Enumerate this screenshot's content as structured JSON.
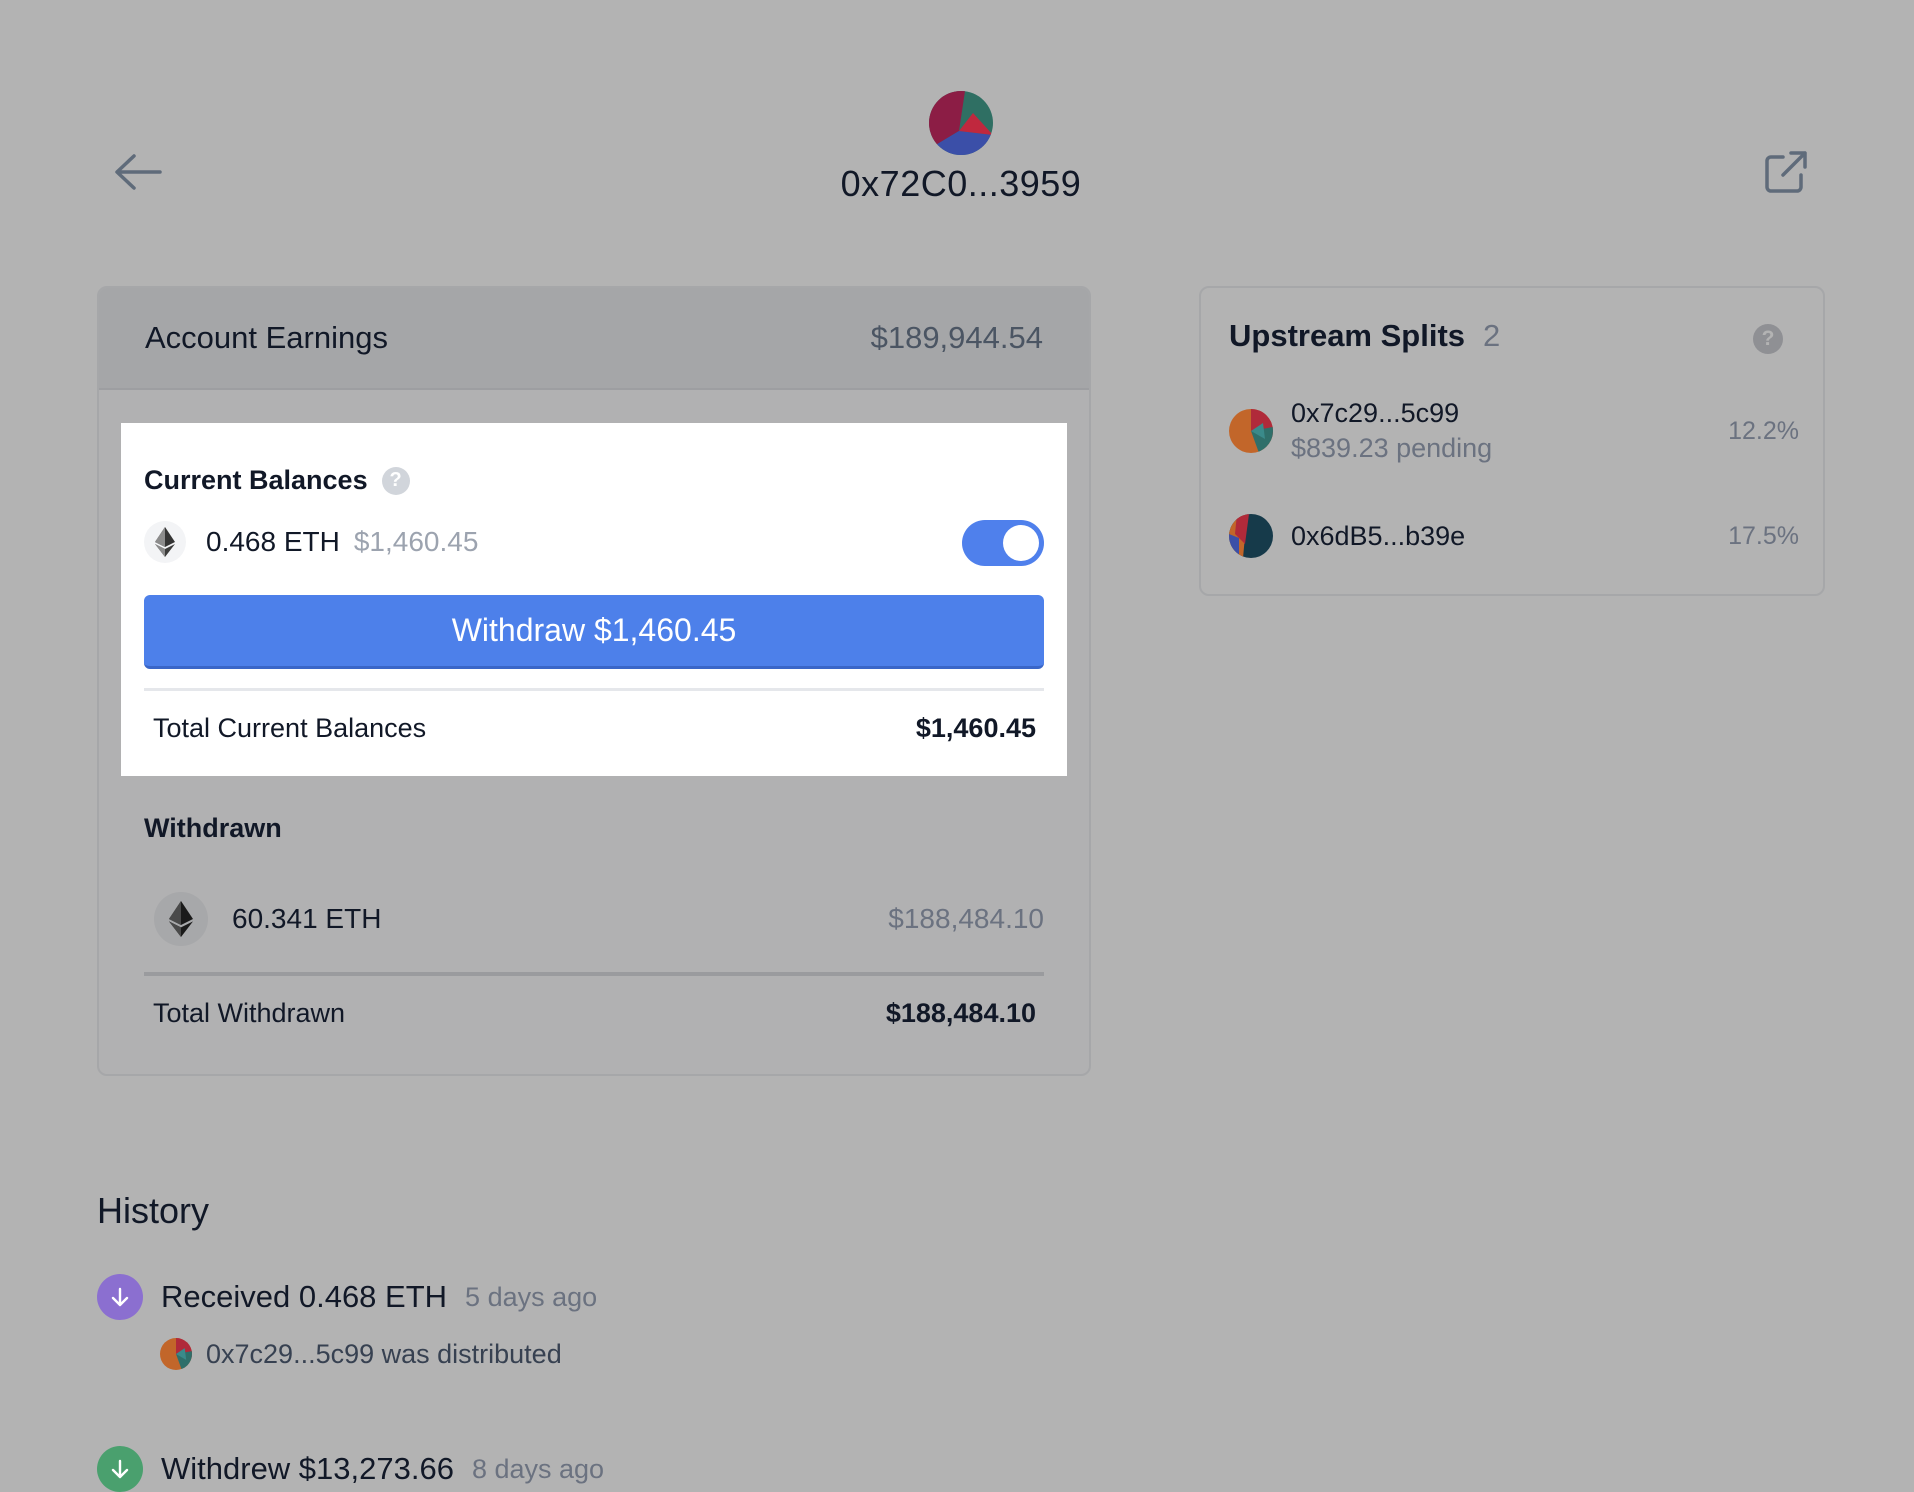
{
  "header": {
    "title": "0x72C0...3959"
  },
  "earnings": {
    "title": "Account Earnings",
    "total": "$189,944.54",
    "current_balances": {
      "title": "Current Balances",
      "help": "?",
      "token_amount": "0.468 ETH",
      "token_usd": "$1,460.45",
      "toggle_on": true,
      "withdraw_label": "Withdraw $1,460.45",
      "total_label": "Total Current Balances",
      "total_value": "$1,460.45"
    },
    "withdrawn": {
      "title": "Withdrawn",
      "token_amount": "60.341 ETH",
      "token_usd": "$188,484.10",
      "total_label": "Total Withdrawn",
      "total_value": "$188,484.10"
    }
  },
  "upstream": {
    "title": "Upstream Splits",
    "count": "2",
    "help": "?",
    "items": [
      {
        "address": "0x7c29...5c99",
        "pending": "$839.23 pending",
        "percent": "12.2%"
      },
      {
        "address": "0x6dB5...b39e",
        "percent": "17.5%"
      }
    ]
  },
  "history": {
    "title": "History",
    "items": [
      {
        "text": "Received 0.468 ETH",
        "time": "5 days ago",
        "sub": "0x7c29...5c99 was distributed"
      },
      {
        "text": "Withdrew $13,273.66",
        "time": "8 days ago"
      }
    ]
  },
  "colors": {
    "accent": "#4d80ea",
    "received_icon": "#8b6fd0",
    "withdrew_icon": "#4aa06e"
  }
}
